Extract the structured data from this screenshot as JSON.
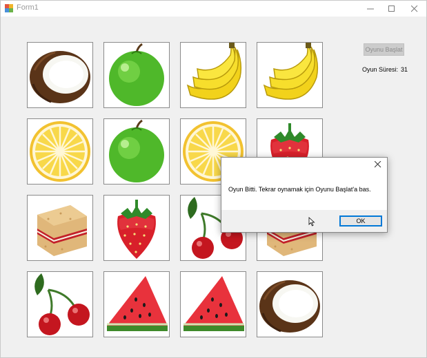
{
  "window": {
    "title": "Form1",
    "minimize_icon": "minimize-icon",
    "maximize_icon": "maximize-icon",
    "close_icon": "close-icon"
  },
  "cards": [
    {
      "fruit": "coconut"
    },
    {
      "fruit": "green-apple"
    },
    {
      "fruit": "banana"
    },
    {
      "fruit": "banana"
    },
    {
      "fruit": "lemon"
    },
    {
      "fruit": "green-apple"
    },
    {
      "fruit": "lemon"
    },
    {
      "fruit": "strawberry"
    },
    {
      "fruit": "cake"
    },
    {
      "fruit": "strawberry"
    },
    {
      "fruit": "cherry"
    },
    {
      "fruit": "cake"
    },
    {
      "fruit": "cherry"
    },
    {
      "fruit": "watermelon"
    },
    {
      "fruit": "watermelon"
    },
    {
      "fruit": "coconut"
    }
  ],
  "sidebar": {
    "start_button": "Oyunu Başlat",
    "time_label": "Oyun Süresi:",
    "time_value": "31"
  },
  "dialog": {
    "message": "Oyun Bitti. Tekrar oynamak için Oyunu Başlat'a bas.",
    "ok_label": "OK",
    "close_icon": "close-icon"
  },
  "colors": {
    "ok_border": "#0078d7",
    "window_bg": "#f0f0f0"
  }
}
